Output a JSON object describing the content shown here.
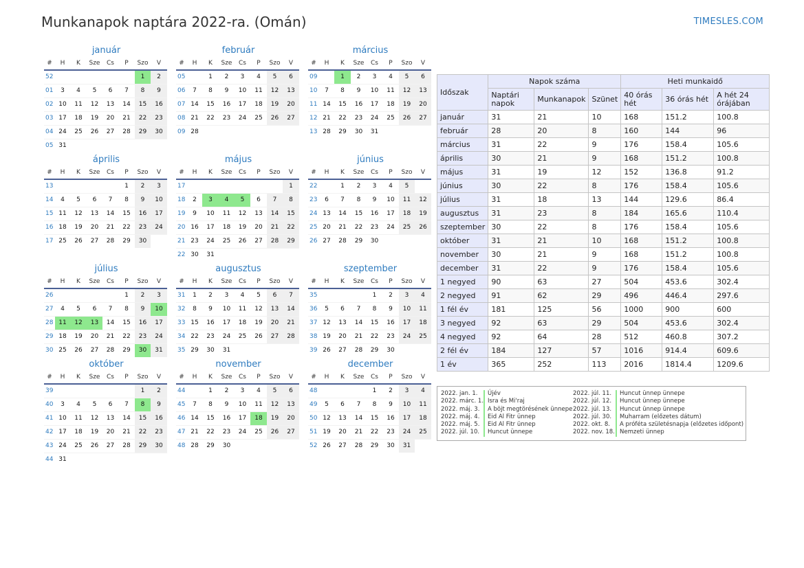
{
  "title": "Munkanapok naptára 2022-ra. (Omán)",
  "brand": "TIMESLES.COM",
  "colors": {
    "accent": "#2e7bbf",
    "holiday": "#8ee88e",
    "weekend": "#efefef",
    "header_fill": "#e6e9fb"
  },
  "weekday_headers": [
    "#",
    "H",
    "K",
    "Sze",
    "Cs",
    "P",
    "Szo",
    "V"
  ],
  "months": [
    {
      "name": "január",
      "rows": [
        [
          "52",
          "",
          "",
          "",
          "",
          "",
          "1",
          "2"
        ],
        [
          "01",
          "3",
          "4",
          "5",
          "6",
          "7",
          "8",
          "9"
        ],
        [
          "02",
          "10",
          "11",
          "12",
          "13",
          "14",
          "15",
          "16"
        ],
        [
          "03",
          "17",
          "18",
          "19",
          "20",
          "21",
          "22",
          "23"
        ],
        [
          "04",
          "24",
          "25",
          "26",
          "27",
          "28",
          "29",
          "30"
        ],
        [
          "05",
          "31",
          "",
          "",
          "",
          "",
          "",
          ""
        ]
      ],
      "holidays": [
        "1"
      ]
    },
    {
      "name": "február",
      "rows": [
        [
          "05",
          "",
          "1",
          "2",
          "3",
          "4",
          "5",
          "6"
        ],
        [
          "06",
          "7",
          "8",
          "9",
          "10",
          "11",
          "12",
          "13"
        ],
        [
          "07",
          "14",
          "15",
          "16",
          "17",
          "18",
          "19",
          "20"
        ],
        [
          "08",
          "21",
          "22",
          "23",
          "24",
          "25",
          "26",
          "27"
        ],
        [
          "09",
          "28",
          "",
          "",
          "",
          "",
          "",
          ""
        ]
      ],
      "holidays": []
    },
    {
      "name": "március",
      "rows": [
        [
          "09",
          "",
          "1",
          "2",
          "3",
          "4",
          "5",
          "6"
        ],
        [
          "10",
          "7",
          "8",
          "9",
          "10",
          "11",
          "12",
          "13"
        ],
        [
          "11",
          "14",
          "15",
          "16",
          "17",
          "18",
          "19",
          "20"
        ],
        [
          "12",
          "21",
          "22",
          "23",
          "24",
          "25",
          "26",
          "27"
        ],
        [
          "13",
          "28",
          "29",
          "30",
          "31",
          "",
          "",
          ""
        ]
      ],
      "holidays": [
        "1"
      ]
    },
    {
      "name": "április",
      "rows": [
        [
          "13",
          "",
          "",
          "",
          "",
          "1",
          "2",
          "3"
        ],
        [
          "14",
          "4",
          "5",
          "6",
          "7",
          "8",
          "9",
          "10"
        ],
        [
          "15",
          "11",
          "12",
          "13",
          "14",
          "15",
          "16",
          "17"
        ],
        [
          "16",
          "18",
          "19",
          "20",
          "21",
          "22",
          "23",
          "24"
        ],
        [
          "17",
          "25",
          "26",
          "27",
          "28",
          "29",
          "30",
          ""
        ]
      ],
      "holidays": []
    },
    {
      "name": "május",
      "rows": [
        [
          "17",
          "",
          "",
          "",
          "",
          "",
          "",
          "1"
        ],
        [
          "18",
          "2",
          "3",
          "4",
          "5",
          "6",
          "7",
          "8"
        ],
        [
          "19",
          "9",
          "10",
          "11",
          "12",
          "13",
          "14",
          "15"
        ],
        [
          "20",
          "16",
          "17",
          "18",
          "19",
          "20",
          "21",
          "22"
        ],
        [
          "21",
          "23",
          "24",
          "25",
          "26",
          "27",
          "28",
          "29"
        ],
        [
          "22",
          "30",
          "31",
          "",
          "",
          "",
          "",
          ""
        ]
      ],
      "holidays": [
        "3",
        "4",
        "5"
      ]
    },
    {
      "name": "június",
      "rows": [
        [
          "22",
          "",
          "1",
          "2",
          "3",
          "4",
          "5",
          ""
        ],
        [
          "23",
          "6",
          "7",
          "8",
          "9",
          "10",
          "11",
          "12"
        ],
        [
          "24",
          "13",
          "14",
          "15",
          "16",
          "17",
          "18",
          "19"
        ],
        [
          "25",
          "20",
          "21",
          "22",
          "23",
          "24",
          "25",
          "26"
        ],
        [
          "26",
          "27",
          "28",
          "29",
          "30",
          "",
          "",
          ""
        ]
      ],
      "holidays": []
    },
    {
      "name": "július",
      "rows": [
        [
          "26",
          "",
          "",
          "",
          "",
          "1",
          "2",
          "3"
        ],
        [
          "27",
          "4",
          "5",
          "6",
          "7",
          "8",
          "9",
          "10"
        ],
        [
          "28",
          "11",
          "12",
          "13",
          "14",
          "15",
          "16",
          "17"
        ],
        [
          "29",
          "18",
          "19",
          "20",
          "21",
          "22",
          "23",
          "24"
        ],
        [
          "30",
          "25",
          "26",
          "27",
          "28",
          "29",
          "30",
          "31"
        ]
      ],
      "holidays": [
        "10",
        "11",
        "12",
        "13",
        "30"
      ]
    },
    {
      "name": "augusztus",
      "rows": [
        [
          "31",
          "1",
          "2",
          "3",
          "4",
          "5",
          "6",
          "7"
        ],
        [
          "32",
          "8",
          "9",
          "10",
          "11",
          "12",
          "13",
          "14"
        ],
        [
          "33",
          "15",
          "16",
          "17",
          "18",
          "19",
          "20",
          "21"
        ],
        [
          "34",
          "22",
          "23",
          "24",
          "25",
          "26",
          "27",
          "28"
        ],
        [
          "35",
          "29",
          "30",
          "31",
          "",
          "",
          "",
          ""
        ]
      ],
      "holidays": []
    },
    {
      "name": "szeptember",
      "rows": [
        [
          "35",
          "",
          "",
          "",
          "1",
          "2",
          "3",
          "4"
        ],
        [
          "36",
          "5",
          "6",
          "7",
          "8",
          "9",
          "10",
          "11"
        ],
        [
          "37",
          "12",
          "13",
          "14",
          "15",
          "16",
          "17",
          "18"
        ],
        [
          "38",
          "19",
          "20",
          "21",
          "22",
          "23",
          "24",
          "25"
        ],
        [
          "39",
          "26",
          "27",
          "28",
          "29",
          "30",
          "",
          ""
        ]
      ],
      "holidays": []
    },
    {
      "name": "október",
      "rows": [
        [
          "39",
          "",
          "",
          "",
          "",
          "",
          "1",
          "2"
        ],
        [
          "40",
          "3",
          "4",
          "5",
          "6",
          "7",
          "8",
          "9"
        ],
        [
          "41",
          "10",
          "11",
          "12",
          "13",
          "14",
          "15",
          "16"
        ],
        [
          "42",
          "17",
          "18",
          "19",
          "20",
          "21",
          "22",
          "23"
        ],
        [
          "43",
          "24",
          "25",
          "26",
          "27",
          "28",
          "29",
          "30"
        ],
        [
          "44",
          "31",
          "",
          "",
          "",
          "",
          "",
          ""
        ]
      ],
      "holidays": [
        "8"
      ]
    },
    {
      "name": "november",
      "rows": [
        [
          "44",
          "",
          "1",
          "2",
          "3",
          "4",
          "5",
          "6"
        ],
        [
          "45",
          "7",
          "8",
          "9",
          "10",
          "11",
          "12",
          "13"
        ],
        [
          "46",
          "14",
          "15",
          "16",
          "17",
          "18",
          "19",
          "20"
        ],
        [
          "47",
          "21",
          "22",
          "23",
          "24",
          "25",
          "26",
          "27"
        ],
        [
          "48",
          "28",
          "29",
          "30",
          "",
          "",
          "",
          ""
        ]
      ],
      "holidays": [
        "18"
      ]
    },
    {
      "name": "december",
      "rows": [
        [
          "48",
          "",
          "",
          "",
          "1",
          "2",
          "3",
          "4"
        ],
        [
          "49",
          "5",
          "6",
          "7",
          "8",
          "9",
          "10",
          "11"
        ],
        [
          "50",
          "12",
          "13",
          "14",
          "15",
          "16",
          "17",
          "18"
        ],
        [
          "51",
          "19",
          "20",
          "21",
          "22",
          "23",
          "24",
          "25"
        ],
        [
          "52",
          "26",
          "27",
          "28",
          "29",
          "30",
          "31",
          ""
        ]
      ],
      "holidays": []
    }
  ],
  "stats": {
    "period_header": "Időszak",
    "days_group": "Napok száma",
    "hours_group": "Heti munkaidő",
    "columns": [
      "Naptári napok",
      "Munkanapok",
      "Szünet",
      "40 órás hét",
      "36 órás hét",
      "A hét 24 órájában"
    ],
    "rows": [
      [
        "január",
        "31",
        "21",
        "10",
        "168",
        "151.2",
        "100.8"
      ],
      [
        "február",
        "28",
        "20",
        "8",
        "160",
        "144",
        "96"
      ],
      [
        "március",
        "31",
        "22",
        "9",
        "176",
        "158.4",
        "105.6"
      ],
      [
        "április",
        "30",
        "21",
        "9",
        "168",
        "151.2",
        "100.8"
      ],
      [
        "május",
        "31",
        "19",
        "12",
        "152",
        "136.8",
        "91.2"
      ],
      [
        "június",
        "30",
        "22",
        "8",
        "176",
        "158.4",
        "105.6"
      ],
      [
        "július",
        "31",
        "18",
        "13",
        "144",
        "129.6",
        "86.4"
      ],
      [
        "augusztus",
        "31",
        "23",
        "8",
        "184",
        "165.6",
        "110.4"
      ],
      [
        "szeptember",
        "30",
        "22",
        "8",
        "176",
        "158.4",
        "105.6"
      ],
      [
        "október",
        "31",
        "21",
        "10",
        "168",
        "151.2",
        "100.8"
      ],
      [
        "november",
        "30",
        "21",
        "9",
        "168",
        "151.2",
        "100.8"
      ],
      [
        "december",
        "31",
        "22",
        "9",
        "176",
        "158.4",
        "105.6"
      ],
      [
        "1 negyed",
        "90",
        "63",
        "27",
        "504",
        "453.6",
        "302.4"
      ],
      [
        "2 negyed",
        "91",
        "62",
        "29",
        "496",
        "446.4",
        "297.6"
      ],
      [
        "1 fél év",
        "181",
        "125",
        "56",
        "1000",
        "900",
        "600"
      ],
      [
        "3 negyed",
        "92",
        "63",
        "29",
        "504",
        "453.6",
        "302.4"
      ],
      [
        "4 negyed",
        "92",
        "64",
        "28",
        "512",
        "460.8",
        "307.2"
      ],
      [
        "2 fél év",
        "184",
        "127",
        "57",
        "1016",
        "914.4",
        "609.6"
      ],
      [
        "1 év",
        "365",
        "252",
        "113",
        "2016",
        "1814.4",
        "1209.6"
      ]
    ]
  },
  "holidays_list": [
    [
      {
        "date": "2022. jan. 1.",
        "name": "Újév"
      },
      {
        "date": "2022. márc. 1.",
        "name": "Isra és Mi'raj"
      },
      {
        "date": "2022. máj. 3.",
        "name": "A böjt megtörésének ünnepe"
      },
      {
        "date": "2022. máj. 4.",
        "name": "Eid Al Fitr ünnep"
      },
      {
        "date": "2022. máj. 5.",
        "name": "Eid Al Fitr ünnep"
      },
      {
        "date": "2022. júl. 10.",
        "name": "Huncut ünnepe"
      }
    ],
    [
      {
        "date": "2022. júl. 11.",
        "name": "Huncut ünnep ünnepe"
      },
      {
        "date": "2022. júl. 12.",
        "name": "Huncut ünnep ünnepe"
      },
      {
        "date": "2022. júl. 13.",
        "name": "Huncut ünnep ünnepe"
      },
      {
        "date": "2022. júl. 30.",
        "name": "Muharram (előzetes dátum)"
      },
      {
        "date": "2022. okt. 8.",
        "name": "A próféta születésnapja (előzetes időpont)"
      },
      {
        "date": "2022. nov. 18.",
        "name": "Nemzeti ünnep"
      }
    ]
  ]
}
